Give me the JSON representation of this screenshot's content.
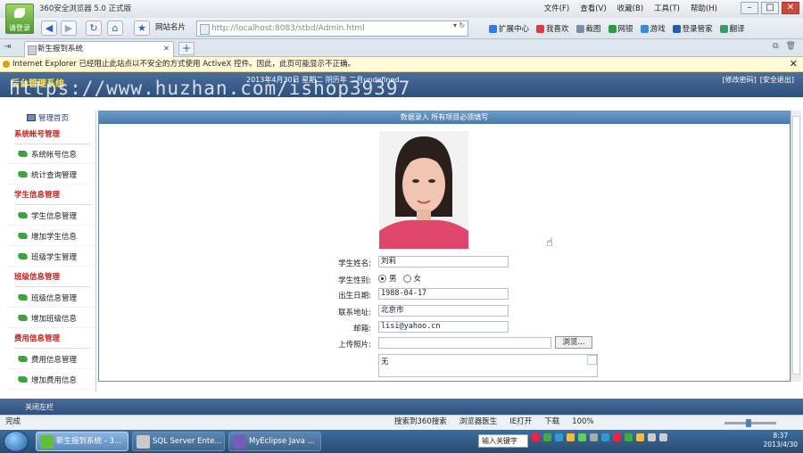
{
  "browser": {
    "title": "360安全浏览器 5.0 正式版",
    "logo_label": "请登录",
    "menu": [
      "文件(F)",
      "查看(V)",
      "收藏(B)",
      "工具(T)",
      "帮助(H)"
    ],
    "favorites_label": "网站名片",
    "address": "http://localhost:8083/stbd/Admin.html",
    "toolbar_items": [
      "扩展中心",
      "我喜欢",
      "截图",
      "网银",
      "游戏",
      "登录管家",
      "翻译"
    ],
    "tab_title": "新生报到系统",
    "infobar": "Internet Explorer 已经阻止此站点以不安全的方式使用 ActiveX 控件。因此，此页可能显示不正确。"
  },
  "app": {
    "system_name": "后台管理系统",
    "date_bar": "2013年4月30日 星期二 阴历年 二月undefined",
    "header_links": [
      "[修改密码]",
      "[安全退出]"
    ],
    "watermark": "https://www.huzhan.com/ishop39397",
    "sidebar_home": "管理首页",
    "sidebar": [
      {
        "group": "系统帐号管理",
        "items": [
          "系统帐号信息",
          "统计查询管理"
        ]
      },
      {
        "group": "学生信息管理",
        "items": [
          "学生信息管理",
          "增加学生信息",
          "班级学生管理"
        ]
      },
      {
        "group": "班级信息管理",
        "items": [
          "班级信息管理",
          "增加班级信息"
        ]
      },
      {
        "group": "费用信息管理",
        "items": [
          "费用信息管理",
          "增加费用信息"
        ]
      }
    ],
    "main_header": "数据录入 所有项目必须填写",
    "form": {
      "name_label": "学生姓名:",
      "name_value": "刘莉",
      "gender_label": "学生性别:",
      "gender_options": [
        "男",
        "女"
      ],
      "gender_selected": "男",
      "birth_label": "出生日期:",
      "birth_value": "1988-04-17",
      "address_label": "联系地址:",
      "address_value": "北京市",
      "email_label": "邮箱:",
      "email_value": "lisi@yahoo.cn",
      "photo_label": "上传照片:",
      "browse_label": "浏览...",
      "remark_value": "无"
    },
    "footer_left": "关闭左栏"
  },
  "statusbar": {
    "left": "完成",
    "items": [
      "搜索到360搜索",
      "浏览器医生",
      "IE打开",
      "下载",
      "100%"
    ]
  },
  "taskbar": {
    "tasks": [
      "新生报到系统 - 3...",
      "SQL Server Ente...",
      "MyEclipse Java ..."
    ],
    "ime": "输入关键字",
    "time": "8:37",
    "date": "2013/4/30"
  },
  "colors": {
    "header_bg": "#3d5f8c",
    "group_red": "#c02020",
    "system_name_yellow": "#ffe34a",
    "icon_green": "#3ea33e"
  }
}
